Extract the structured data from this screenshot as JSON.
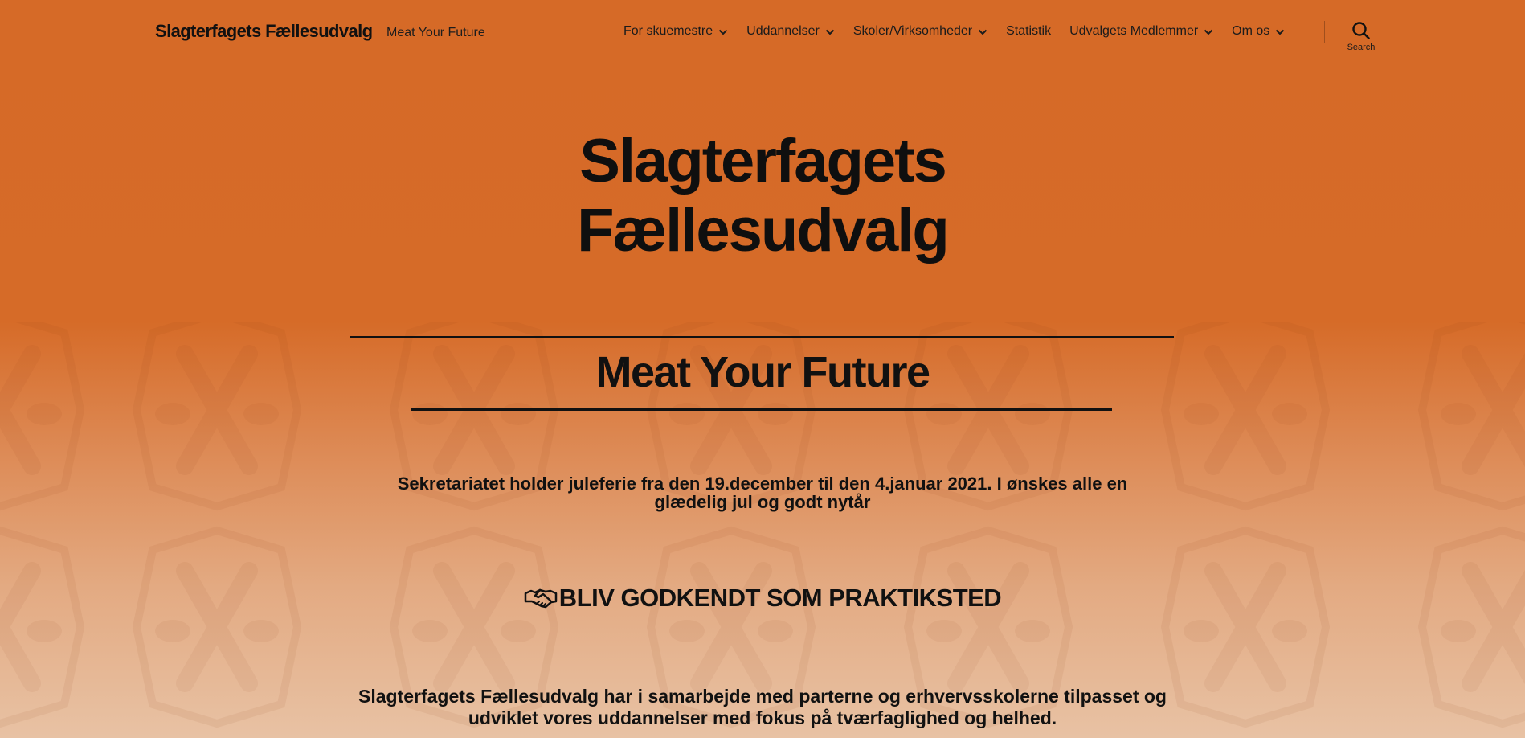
{
  "header": {
    "site_title": "Slagterfagets Fællesudvalg",
    "tagline": "Meat Your Future",
    "nav": [
      {
        "label": "For skuemestre",
        "has_submenu": true
      },
      {
        "label": "Uddannelser",
        "has_submenu": true
      },
      {
        "label": "Skoler/Virksomheder",
        "has_submenu": true
      },
      {
        "label": "Statistik",
        "has_submenu": false
      },
      {
        "label": "Udvalgets Medlemmer",
        "has_submenu": true
      },
      {
        "label": "Om os",
        "has_submenu": true
      }
    ],
    "search_label": "Search"
  },
  "hero": {
    "title_line1": "Slagterfagets",
    "title_line2": "Fællesudvalg"
  },
  "main": {
    "subtitle": "Meat Your Future",
    "notice": "Sekretariatet holder juleferie fra den 19.december til den 4.januar 2021. I ønskes alle en glædelig jul og godt nytår",
    "cta_heading": "BLIV GODKENDT SOM PRAKTIKSTED",
    "intro": "Slagterfagets Fællesudvalg har i samarbejde med parterne og erhvervsskolerne tilpasset og udviklet vores uddannelser med fokus på tværfaglighed og helhed."
  },
  "colors": {
    "background_top": "#d66a27",
    "background_bottom": "#e8c2a4",
    "text": "#111111"
  },
  "icons": {
    "submenu": "chevron-down-icon",
    "search": "search-icon",
    "cta": "handshake-icon"
  }
}
